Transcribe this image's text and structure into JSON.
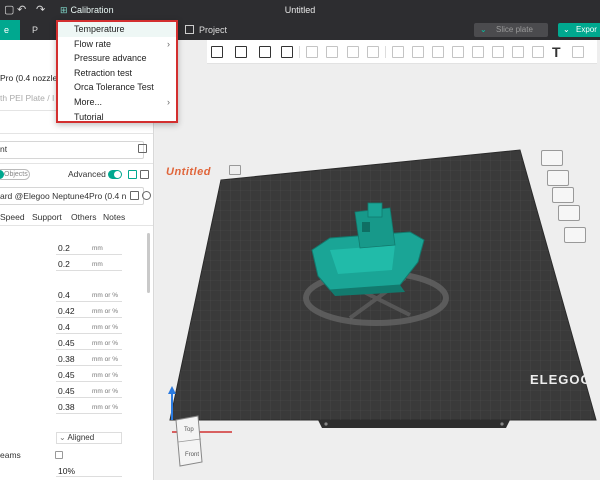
{
  "window": {
    "title": "Untitled"
  },
  "titlebar": {
    "calibration_label": "Calibration",
    "undo_glyph": "↶",
    "redo_glyph": "↷"
  },
  "calibration_menu": {
    "items": [
      {
        "label": "Temperature",
        "submenu": false,
        "active": true
      },
      {
        "label": "Flow rate",
        "submenu": true
      },
      {
        "label": "Pressure advance",
        "submenu": false
      },
      {
        "label": "Retraction test",
        "submenu": false
      },
      {
        "label": "Orca Tolerance Test",
        "submenu": false
      },
      {
        "label": "More...",
        "submenu": true
      },
      {
        "label": "Tutorial",
        "submenu": false
      }
    ],
    "chevron": "›"
  },
  "tabs": {
    "prepare": "e",
    "preview": "P",
    "project": "Project"
  },
  "actions": {
    "slice_plate": "Slice plate",
    "export": "Expor"
  },
  "left_panel": {
    "printer_name": "Pro (0.4 nozzle",
    "plate_type": "th PEI Plate / I",
    "filament_label": "nt",
    "objects_toggle": "Objects",
    "advanced_label": "Advanced",
    "process_preset": "ard @Elegoo Neptune4Pro (0.4 n",
    "tabs": [
      "Speed",
      "Support",
      "Others",
      "Notes"
    ],
    "values": [
      {
        "value": "0.2",
        "unit": "mm"
      },
      {
        "value": "0.2",
        "unit": "mm"
      },
      {
        "value": "0.4",
        "unit": "mm or %"
      },
      {
        "value": "0.42",
        "unit": "mm or %"
      },
      {
        "value": "0.4",
        "unit": "mm or %"
      },
      {
        "value": "0.45",
        "unit": "mm or %"
      },
      {
        "value": "0.38",
        "unit": "mm or %"
      },
      {
        "value": "0.45",
        "unit": "mm or %"
      },
      {
        "value": "0.45",
        "unit": "mm or %"
      },
      {
        "value": "0.38",
        "unit": "mm or %"
      }
    ],
    "seam_position": "Aligned",
    "seams_label": "eams",
    "infill_value": "10%"
  },
  "viewport": {
    "plate_name": "Untitled",
    "bed_brand": "ELEGOO",
    "cube_top": "Top",
    "cube_front": "Front"
  },
  "colors": {
    "accent": "#00a88f",
    "titlebar": "#2d2d30",
    "bed": "#3c3c3c",
    "model": "#1aa596",
    "highlight_border": "#d32f2f",
    "plate_label": "#e0653a"
  }
}
